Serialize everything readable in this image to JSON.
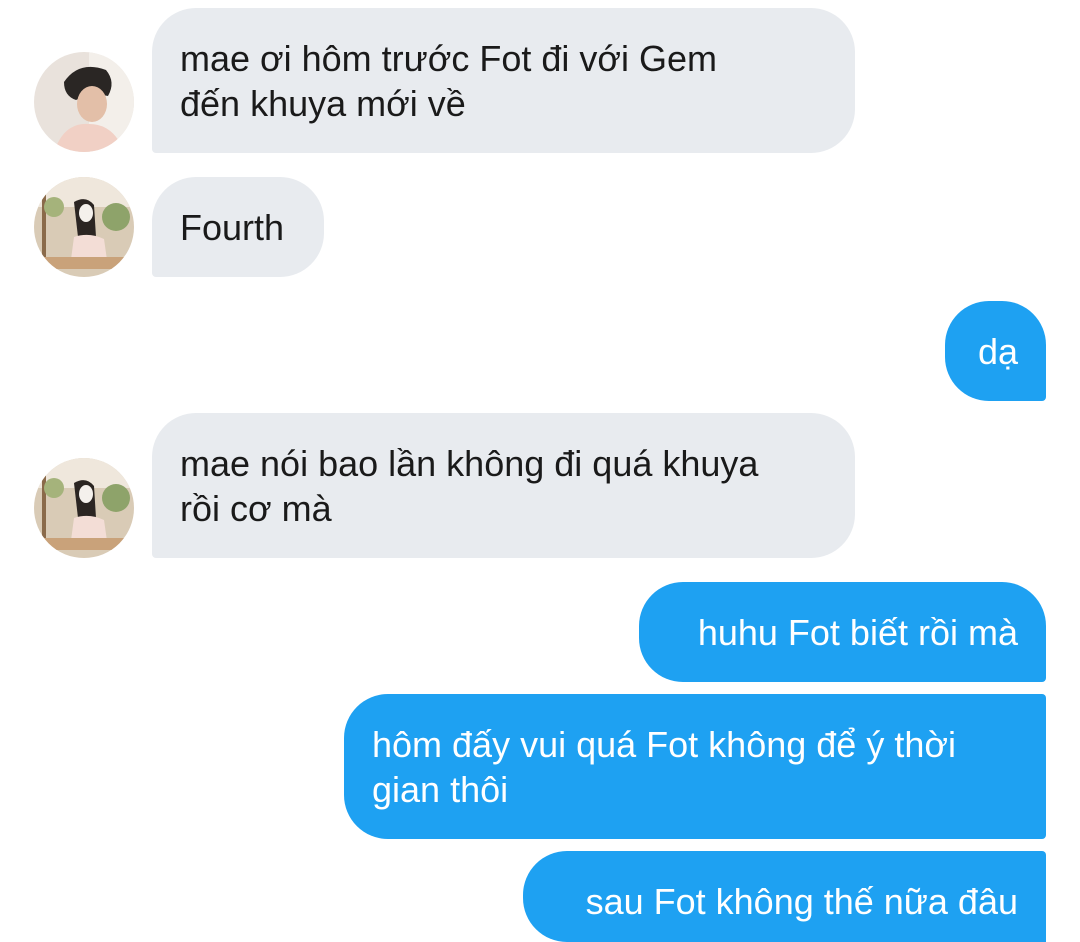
{
  "messages": [
    {
      "sender": "other",
      "text": "mae ơi hôm trước Fot đi với Gem\nđến khuya mới về",
      "avatar": "avatar-boy-photo"
    },
    {
      "sender": "other",
      "text": "Fourth",
      "avatar": "avatar-girl-photo"
    },
    {
      "sender": "me",
      "text": "dạ"
    },
    {
      "sender": "other",
      "text": "mae nói bao lần không đi quá khuya\nrồi cơ mà",
      "avatar": "avatar-girl-photo"
    },
    {
      "sender": "me",
      "text": "huhu Fot biết rồi mà"
    },
    {
      "sender": "me",
      "text": "hôm đấy vui quá Fot không để ý thời\ngian thôi"
    },
    {
      "sender": "me",
      "text": "sau Fot không thế nữa đâu"
    }
  ],
  "colors": {
    "incoming_bubble": "#e8ebef",
    "outgoing_bubble": "#1ea1f2",
    "incoming_text": "#1a1a1a",
    "outgoing_text": "#ffffff"
  }
}
